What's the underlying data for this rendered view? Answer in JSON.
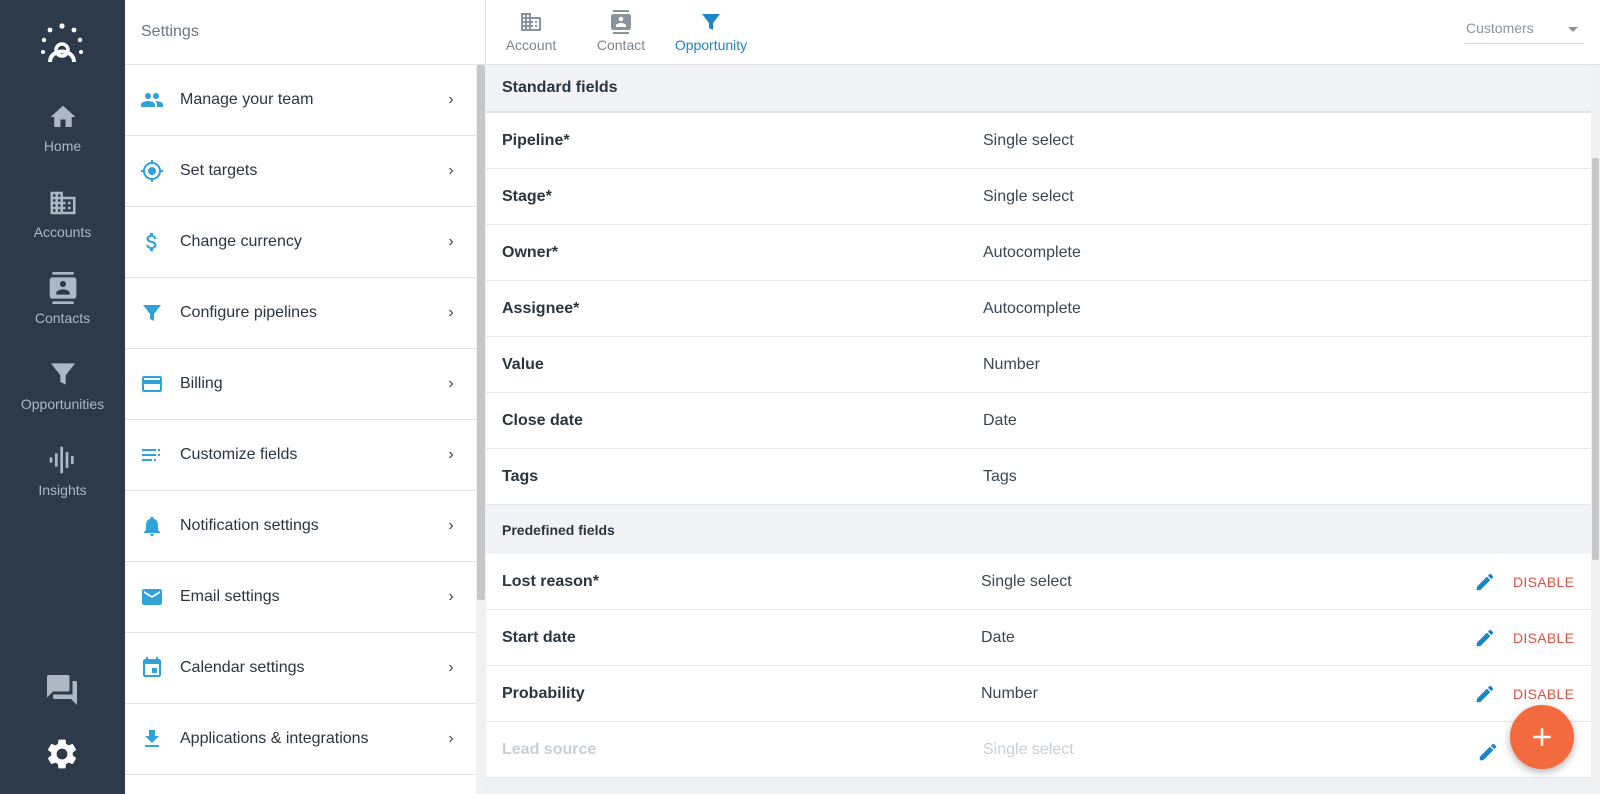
{
  "nav": {
    "items": [
      {
        "label": "Home",
        "icon": "home-icon"
      },
      {
        "label": "Accounts",
        "icon": "building-icon"
      },
      {
        "label": "Contacts",
        "icon": "contact-card-icon"
      },
      {
        "label": "Opportunities",
        "icon": "funnel-icon"
      },
      {
        "label": "Insights",
        "icon": "insights-icon"
      }
    ],
    "bottom": [
      "chat-icon",
      "gear-icon"
    ],
    "bg_color": "#2d3a4a"
  },
  "settings": {
    "title": "Settings",
    "items": [
      {
        "label": "Manage your team",
        "icon": "team-icon"
      },
      {
        "label": "Set targets",
        "icon": "target-icon"
      },
      {
        "label": "Change currency",
        "icon": "dollar-icon"
      },
      {
        "label": "Configure pipelines",
        "icon": "funnel-icon"
      },
      {
        "label": "Billing",
        "icon": "credit-card-icon"
      },
      {
        "label": "Customize fields",
        "icon": "list-icon"
      },
      {
        "label": "Notification settings",
        "icon": "bell-icon"
      },
      {
        "label": "Email settings",
        "icon": "envelope-icon"
      },
      {
        "label": "Calendar settings",
        "icon": "calendar-icon"
      },
      {
        "label": "Applications & integrations",
        "icon": "download-icon"
      }
    ],
    "icon_color": "#2fa3d9"
  },
  "tabs": [
    {
      "label": "Account",
      "icon": "building-icon",
      "active": false
    },
    {
      "label": "Contact",
      "icon": "contact-card-icon",
      "active": false
    },
    {
      "label": "Opportunity",
      "icon": "funnel-icon",
      "active": true
    }
  ],
  "dropdown": {
    "value": "Customers"
  },
  "standard": {
    "title": "Standard fields",
    "rows": [
      {
        "name": "Pipeline*",
        "type": "Single select"
      },
      {
        "name": "Stage*",
        "type": "Single select"
      },
      {
        "name": "Owner*",
        "type": "Autocomplete"
      },
      {
        "name": "Assignee*",
        "type": "Autocomplete"
      },
      {
        "name": "Value",
        "type": "Number"
      },
      {
        "name": "Close date",
        "type": "Date"
      },
      {
        "name": "Tags",
        "type": "Tags"
      }
    ]
  },
  "predefined": {
    "title": "Predefined fields",
    "action_label": "DISABLE",
    "rows": [
      {
        "name": "Lost reason*",
        "type": "Single select"
      },
      {
        "name": "Start date",
        "type": "Date"
      },
      {
        "name": "Probability",
        "type": "Number"
      },
      {
        "name": "Lead source",
        "type": "Single select"
      }
    ]
  },
  "colors": {
    "accent": "#1a86c8",
    "danger": "#e25341",
    "fab": "#f26a3e"
  }
}
